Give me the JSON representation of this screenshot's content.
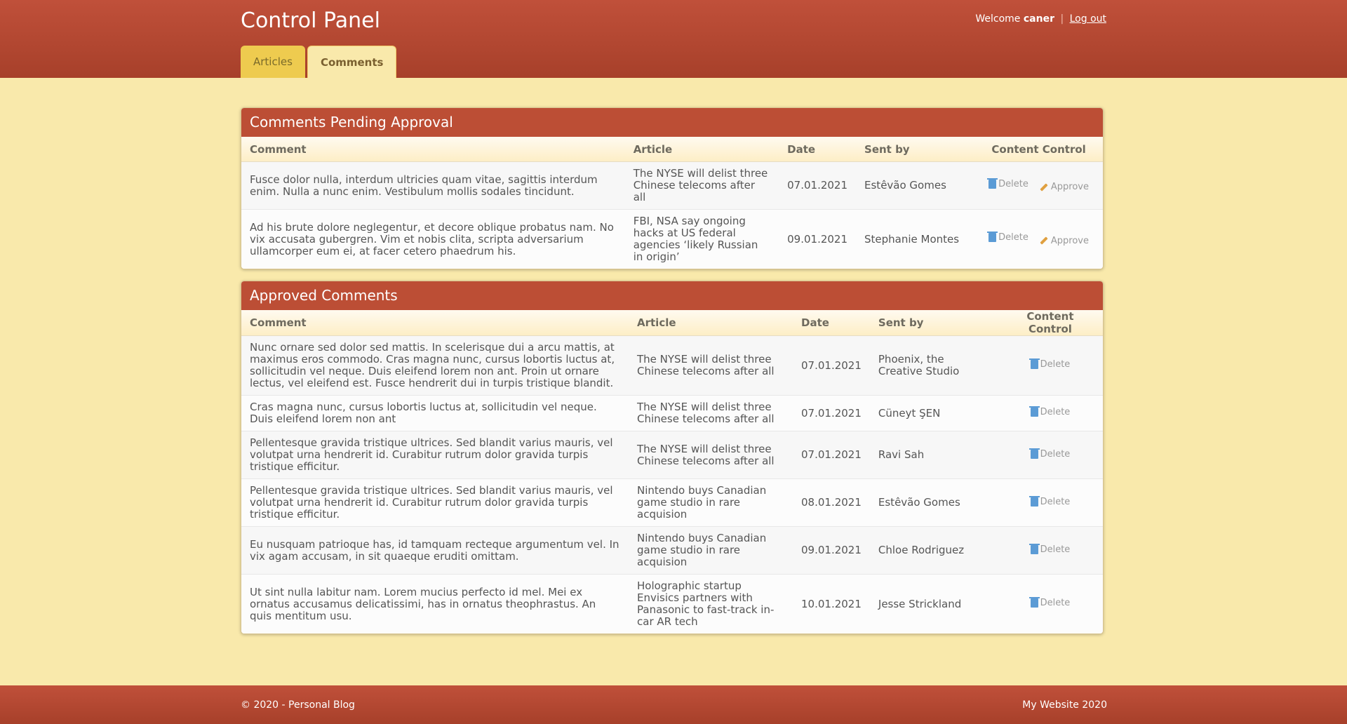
{
  "header": {
    "title": "Control Panel",
    "welcome": "Welcome",
    "username": "caner",
    "separator": "|",
    "logout": "Log out"
  },
  "tabs": [
    {
      "label": "Articles",
      "active": false
    },
    {
      "label": "Comments",
      "active": true
    }
  ],
  "pending": {
    "title": "Comments Pending Approval",
    "columns": [
      "Comment",
      "Article",
      "Date",
      "Sent by",
      "Content Control"
    ],
    "delete_label": "Delete",
    "approve_label": "Approve",
    "rows": [
      {
        "comment": "Fusce dolor nulla, interdum ultricies quam vitae, sagittis interdum enim. Nulla a nunc enim. Vestibulum mollis sodales tincidunt.",
        "article": "The NYSE will delist three Chinese telecoms after all",
        "date": "07.01.2021",
        "sender": "Estêvão Gomes"
      },
      {
        "comment": "Ad his brute dolore neglegentur, et decore oblique probatus nam. No vix accusata gubergren. Vim et nobis clita, scripta adversarium ullamcorper eum ei, at facer cetero phaedrum his.",
        "article": "FBI, NSA say ongoing hacks at US federal agencies ‘likely Russian in origin’",
        "date": "09.01.2021",
        "sender": "Stephanie Montes"
      }
    ]
  },
  "approved": {
    "title": "Approved Comments",
    "columns": [
      "Comment",
      "Article",
      "Date",
      "Sent by",
      "Content Control"
    ],
    "delete_label": "Delete",
    "rows": [
      {
        "comment": "Nunc ornare sed dolor sed mattis. In scelerisque dui a arcu mattis, at maximus eros commodo. Cras magna nunc, cursus lobortis luctus at, sollicitudin vel neque. Duis eleifend lorem non ant. Proin ut ornare lectus, vel eleifend est. Fusce hendrerit dui in turpis tristique blandit.",
        "article": "The NYSE will delist three Chinese telecoms after all",
        "date": "07.01.2021",
        "sender": "Phoenix, the Creative Studio"
      },
      {
        "comment": "Cras magna nunc, cursus lobortis luctus at, sollicitudin vel neque. Duis eleifend lorem non ant",
        "article": "The NYSE will delist three Chinese telecoms after all",
        "date": "07.01.2021",
        "sender": "Cüneyt ŞEN"
      },
      {
        "comment": "Pellentesque gravida tristique ultrices. Sed blandit varius mauris, vel volutpat urna hendrerit id. Curabitur rutrum dolor gravida turpis tristique efficitur.",
        "article": "The NYSE will delist three Chinese telecoms after all",
        "date": "07.01.2021",
        "sender": "Ravi Sah"
      },
      {
        "comment": "Pellentesque gravida tristique ultrices. Sed blandit varius mauris, vel volutpat urna hendrerit id. Curabitur rutrum dolor gravida turpis tristique efficitur.",
        "article": "Nintendo buys Canadian game studio in rare acquision",
        "date": "08.01.2021",
        "sender": "Estêvão Gomes"
      },
      {
        "comment": "Eu nusquam patrioque has, id tamquam recteque argumentum vel. In vix agam accusam, in sit quaeque eruditi omittam.",
        "article": "Nintendo buys Canadian game studio in rare acquision",
        "date": "09.01.2021",
        "sender": "Chloe Rodriguez"
      },
      {
        "comment": "Ut sint nulla labitur nam. Lorem mucius perfecto id mel. Mei ex ornatus accusamus delicatissimi, has in ornatus theophrastus. An quis mentitum usu.",
        "article": "Holographic startup Envisics partners with Panasonic to fast-track in-car AR tech",
        "date": "10.01.2021",
        "sender": "Jesse Strickland"
      }
    ]
  },
  "footer": {
    "left": "© 2020 - Personal Blog",
    "right": "My Website 2020"
  }
}
